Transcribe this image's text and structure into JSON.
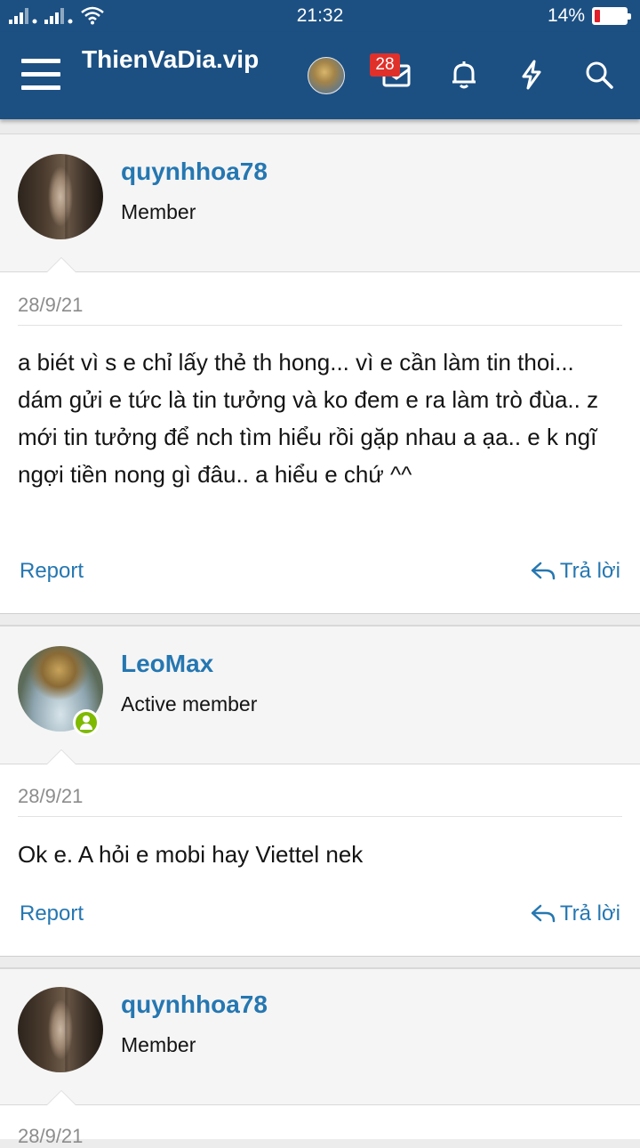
{
  "status_bar": {
    "time": "21:32",
    "battery": "14%"
  },
  "header": {
    "site_title": "ThienVaDia.vip",
    "messages_badge": "28",
    "icons": [
      "menu-icon",
      "avatar",
      "messages-icon",
      "bell-icon",
      "bolt-icon",
      "search-icon"
    ]
  },
  "posts": [
    {
      "username": "quynhhoa78",
      "user_title": "Member",
      "date": "28/9/21",
      "body": "a biét vì s e chỉ lấy thẻ th hong... vì e cần làm tin thoi... dám gửi e tức là tin tưởng và ko đem e ra làm trò đùa.. z mới tin tưởng để nch tìm hiểu rồi gặp nhau a ạa.. e k ngĩ ngợi tiền nong gì đâu.. a hiểu e chứ ^^",
      "report": "Report",
      "reply": "Trả lời"
    },
    {
      "username": "LeoMax",
      "user_title": "Active member",
      "date": "28/9/21",
      "body": "Ok e. A hỏi e mobi hay Viettel nek",
      "report": "Report",
      "reply": "Trả lời"
    },
    {
      "username": "quynhhoa78",
      "user_title": "Member",
      "date": "28/9/21"
    }
  ],
  "colors": {
    "header_bg": "#1c5083",
    "link": "#2577b1",
    "badge": "#e0302a",
    "online": "#7fb900"
  }
}
